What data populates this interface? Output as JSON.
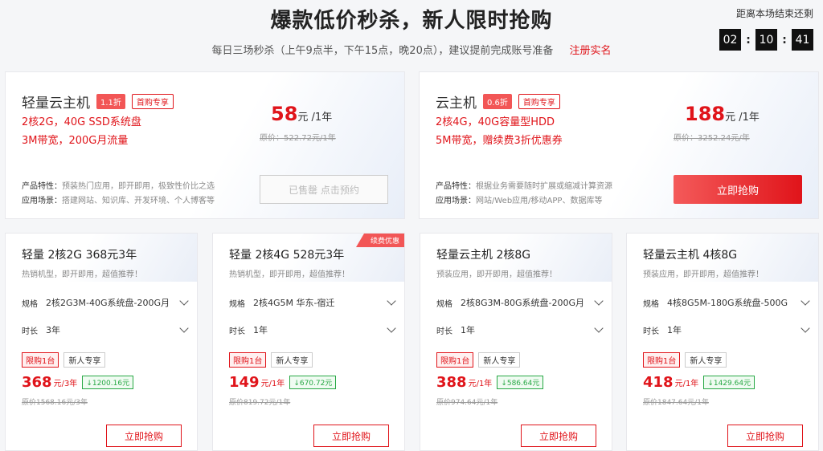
{
  "header": {
    "title": "爆款低价秒杀，新人限时抢购",
    "subtitle": "每日三场秒杀（上午9点半，下午15点，晚20点），建议提前完成账号准备",
    "register_link": "注册实名",
    "countdown_label": "距离本场结束还剩",
    "countdown": {
      "h": "02",
      "m": "10",
      "s": "41"
    }
  },
  "featured": [
    {
      "name": "轻量云主机",
      "discount": "1.1折",
      "first_tag": "首购专享",
      "spec1": "2核2G，40G SSD系统盘",
      "spec2": "3M带宽，200G月流量",
      "price": "58",
      "unit": "元 /1年",
      "orig": "原价：522.72元/1年",
      "feature_label": "产品特性：",
      "feature": "预装热门应用，即开即用，极致性价比之选",
      "scene_label": "应用场景：",
      "scene": "搭建网站、知识库、开发环境、个人博客等",
      "button": "已售罄 点击预约"
    },
    {
      "name": "云主机",
      "discount": "0.6折",
      "first_tag": "首购专享",
      "spec1": "2核4G，40G容量型HDD",
      "spec2": "5M带宽，赠续费3折优惠券",
      "price": "188",
      "unit": "元 /1年",
      "orig": "原价：3252.24元/年",
      "feature_label": "产品特性：",
      "feature": "根据业务需要随时扩展或缩减计算资源",
      "scene_label": "应用场景：",
      "scene": "网站/Web应用/移动APP、数据库等",
      "button": "立即抢购"
    }
  ],
  "cards": [
    {
      "name": "轻量 2核2G 368元3年",
      "desc": "热销机型，即开即用，超值推荐！",
      "spec_label": "规格",
      "spec": "2核2G3M-40G系统盘-200G月",
      "dur_label": "时长",
      "dur": "3年",
      "limit": "限购1台",
      "newbie": "新人专享",
      "price": "368",
      "unit": "元/3年",
      "save": "↓1200.16元",
      "orig": "原价1568.16元/3年",
      "button": "立即抢购"
    },
    {
      "name": "轻量 2核4G 528元3年",
      "badge": "续费优惠",
      "desc": "热销机型，即开即用，超值推荐！",
      "spec_label": "规格",
      "spec": "2核4G5M 华东-宿迁",
      "dur_label": "时长",
      "dur": "1年",
      "limit": "限购1台",
      "newbie": "新人专享",
      "price": "149",
      "unit": "元/1年",
      "save": "↓670.72元",
      "orig": "原价819.72元/1年",
      "button": "立即抢购"
    },
    {
      "name": "轻量云主机 2核8G",
      "desc": "预装应用，即开即用，超值推荐！",
      "spec_label": "规格",
      "spec": "2核8G3M-80G系统盘-200G月",
      "dur_label": "时长",
      "dur": "1年",
      "limit": "限购1台",
      "newbie": "新人专享",
      "price": "388",
      "unit": "元/1年",
      "save": "↓586.64元",
      "orig": "原价974.64元/1年",
      "button": "立即抢购"
    },
    {
      "name": "轻量云主机 4核8G",
      "desc": "预装应用，即开即用，超值推荐！",
      "spec_label": "规格",
      "spec": "4核8G5M-180G系统盘-500G",
      "dur_label": "时长",
      "dur": "1年",
      "limit": "限购1台",
      "newbie": "新人专享",
      "price": "418",
      "unit": "元/1年",
      "save": "↓1429.64元",
      "orig": "原价1847.64元/1年",
      "button": "立即抢购"
    }
  ]
}
